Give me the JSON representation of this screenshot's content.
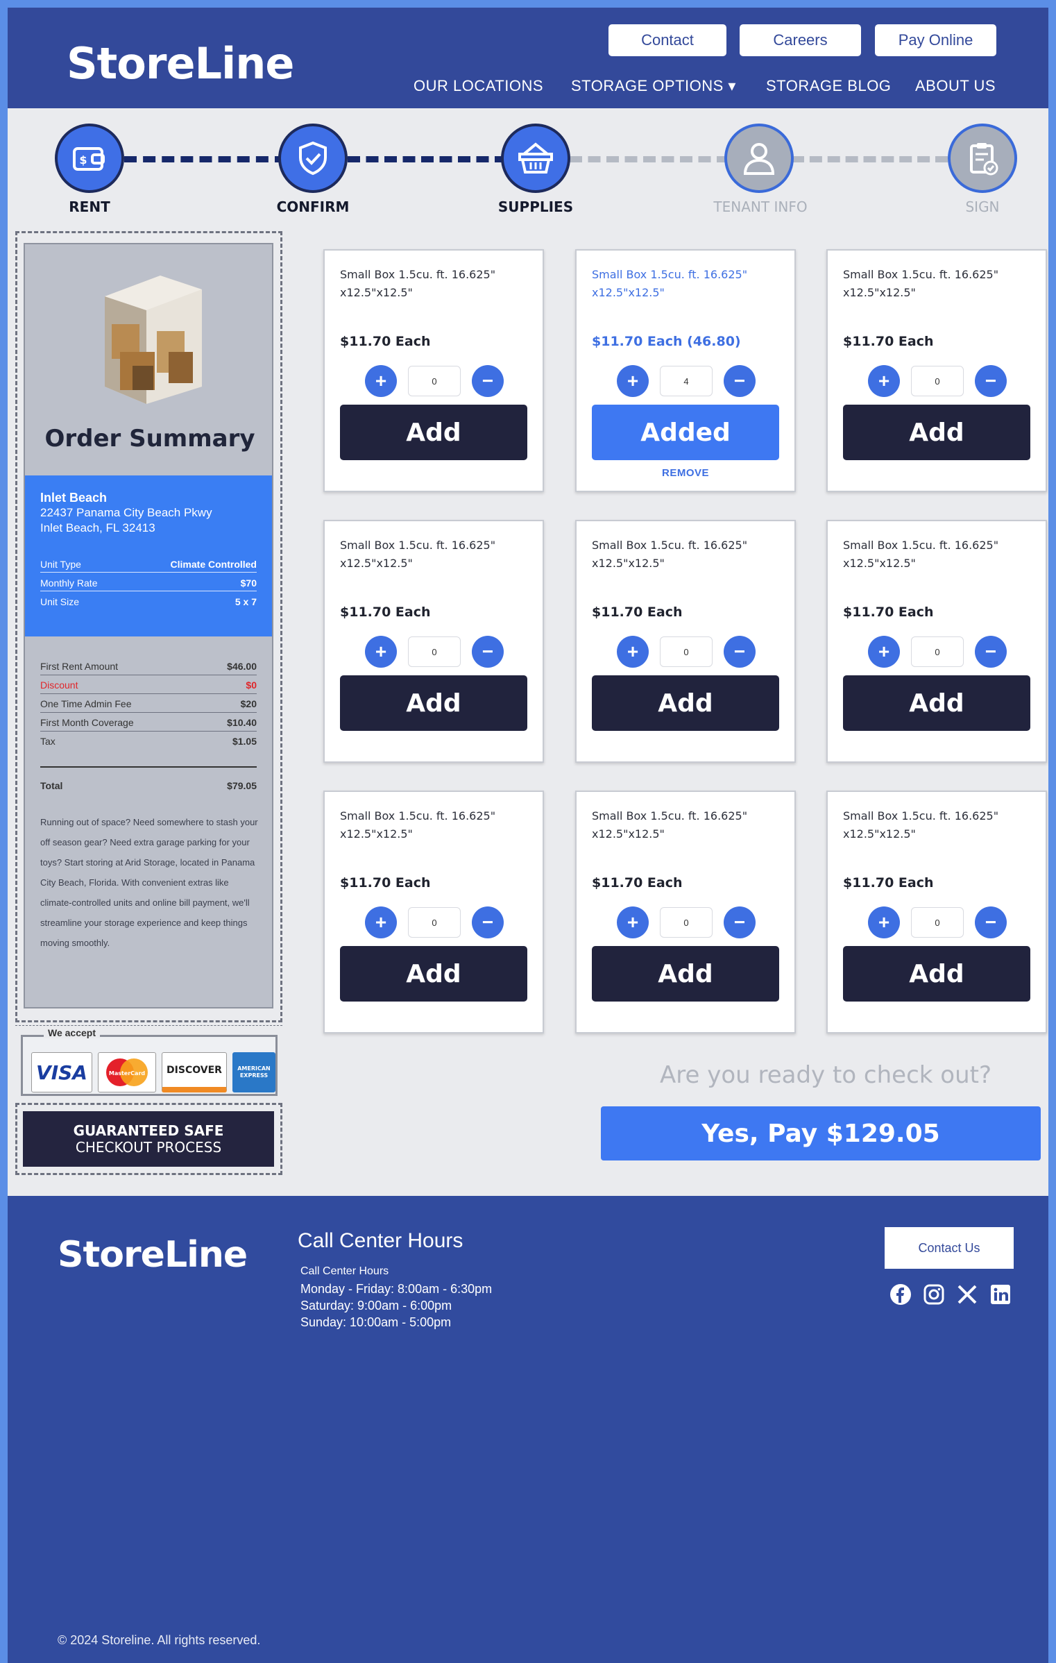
{
  "brand": {
    "name": "StoreLine"
  },
  "top_buttons": [
    {
      "label": "Contact"
    },
    {
      "label": "Careers"
    },
    {
      "label": "Pay Online"
    }
  ],
  "nav": [
    {
      "label": "OUR LOCATIONS"
    },
    {
      "label": "STORAGE OPTIONS ▾"
    },
    {
      "label": "STORAGE BLOG"
    },
    {
      "label": "ABOUT US"
    }
  ],
  "steps": [
    {
      "label": "RENT",
      "icon": "wallet-icon",
      "active": true
    },
    {
      "label": "CONFIRM",
      "icon": "shield-check-icon",
      "active": true
    },
    {
      "label": "SUPPLIES",
      "icon": "basket-icon",
      "active": true
    },
    {
      "label": "TENANT INFO",
      "icon": "user-icon",
      "active": false
    },
    {
      "label": "SIGN",
      "icon": "clipboard-check-icon",
      "active": false
    }
  ],
  "summary": {
    "title": "Order Summary",
    "location_name": "Inlet Beach",
    "address_line1": "22437 Panama City Beach Pkwy",
    "address_line2": "Inlet Beach, FL 32413",
    "unit_rows": [
      {
        "label": "Unit Type",
        "value": "Climate Controlled"
      },
      {
        "label": "Monthly Rate",
        "value": "$70"
      },
      {
        "label": "Unit Size",
        "value": "5 x 7"
      }
    ],
    "fee_rows": [
      {
        "label": "First Rent Amount",
        "value": "$46.00"
      },
      {
        "label": "Discount",
        "value": "$0"
      },
      {
        "label": "One Time Admin Fee",
        "value": "$20"
      },
      {
        "label": "First Month Coverage",
        "value": "$10.40"
      },
      {
        "label": "Tax",
        "value": "$1.05"
      }
    ],
    "total_label": "Total",
    "total_value": "$79.05",
    "description": "Running out of space? Need somewhere to stash your off season gear? Need extra garage parking for your toys? Start storing at Arid Storage, located in Panama City Beach, Florida. With convenient extras like climate-controlled units and online bill payment, we'll streamline your storage experience and keep things moving smoothly."
  },
  "payments": {
    "label": "We accept",
    "cards": [
      {
        "name": "VISA",
        "icon": "visa-icon"
      },
      {
        "name": "MasterCard",
        "icon": "mastercard-icon"
      },
      {
        "name": "DISCOVER",
        "icon": "discover-icon"
      },
      {
        "name": "AMERICAN EXPRESS",
        "icon": "amex-icon"
      }
    ]
  },
  "guarantee": {
    "line1": "GUARANTEED SAFE",
    "line2": "CHECKOUT PROCESS"
  },
  "products": [
    {
      "name": "Small Box 1.5cu. ft. 16.625\" x12.5\"x12.5\"",
      "price": "$11.70 Each",
      "qty": "0",
      "button": "Add",
      "selected": false
    },
    {
      "name": "Small Box 1.5cu. ft. 16.625\" x12.5\"x12.5\"",
      "price": "$11.70 Each (46.80)",
      "qty": "4",
      "button": "Added",
      "selected": true,
      "remove": "REMOVE"
    },
    {
      "name": "Small Box 1.5cu. ft. 16.625\" x12.5\"x12.5\"",
      "price": "$11.70 Each",
      "qty": "0",
      "button": "Add",
      "selected": false
    },
    {
      "name": "Small Box 1.5cu. ft. 16.625\" x12.5\"x12.5\"",
      "price": "$11.70 Each",
      "qty": "0",
      "button": "Add",
      "selected": false
    },
    {
      "name": "Small Box 1.5cu. ft. 16.625\" x12.5\"x12.5\"",
      "price": "$11.70 Each",
      "qty": "0",
      "button": "Add",
      "selected": false
    },
    {
      "name": "Small Box 1.5cu. ft. 16.625\" x12.5\"x12.5\"",
      "price": "$11.70 Each",
      "qty": "0",
      "button": "Add",
      "selected": false
    },
    {
      "name": "Small Box 1.5cu. ft. 16.625\" x12.5\"x12.5\"",
      "price": "$11.70 Each",
      "qty": "0",
      "button": "Add",
      "selected": false
    },
    {
      "name": "Small Box 1.5cu. ft. 16.625\" x12.5\"x12.5\"",
      "price": "$11.70 Each",
      "qty": "0",
      "button": "Add",
      "selected": false
    },
    {
      "name": "Small Box 1.5cu. ft. 16.625\" x12.5\"x12.5\"",
      "price": "$11.70 Each",
      "qty": "0",
      "button": "Add",
      "selected": false
    }
  ],
  "checkout": {
    "prompt": "Are you ready to check out?",
    "button": "Yes, Pay $129.05"
  },
  "footer": {
    "brand": "StoreLine",
    "hours_title": "Call Center Hours",
    "hours_lines": [
      "Call Center Hours",
      "Monday - Friday: 8:00am - 6:30pm",
      "Saturday: 9:00am - 6:00pm",
      "Sunday: 10:00am - 5:00pm"
    ],
    "contact_button": "Contact Us",
    "social": [
      "facebook-icon",
      "instagram-icon",
      "x-icon",
      "linkedin-icon"
    ],
    "copyright": "© 2024 Storeline. All rights reserved."
  },
  "colors": {
    "header": "#33499a",
    "accent": "#3e78f2",
    "dark_button": "#21233d",
    "discount": "#e0262a"
  }
}
